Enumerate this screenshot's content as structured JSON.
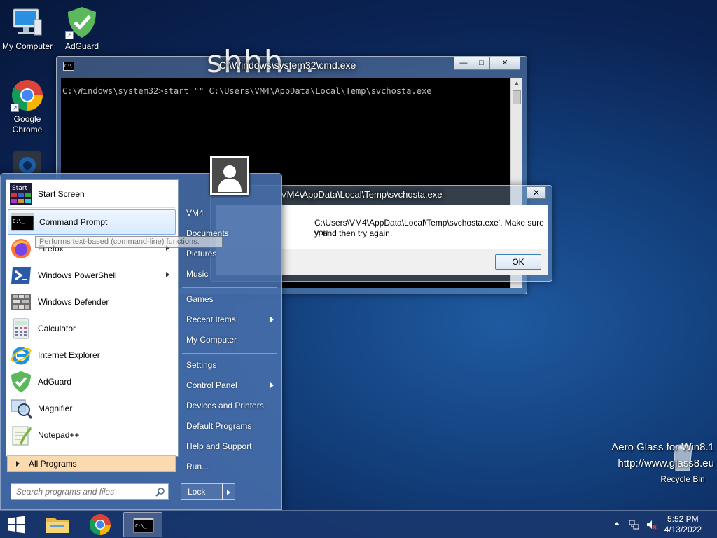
{
  "desktop": {
    "icons": [
      {
        "label": "My Computer"
      },
      {
        "label": "AdGuard"
      },
      {
        "label": "Google Chrome"
      },
      {
        "label": "Recycle Bin"
      }
    ],
    "watermark_line1": "Aero Glass for Win8.1",
    "watermark_line2": "http://www.glass8.eu"
  },
  "cmd_window": {
    "title": "C:\\Windows\\system32\\cmd.exe",
    "overlay_text": "shhh...",
    "console_line": "C:\\Windows\\system32>start \"\" C:\\Users\\VM4\\AppData\\Local\\Temp\\svchosta.exe",
    "minimize": "—",
    "maximize": "□",
    "close": "✕"
  },
  "error_dialog": {
    "title": "VM4\\AppData\\Local\\Temp\\svchosta.exe",
    "message_line1": "C:\\Users\\VM4\\AppData\\Local\\Temp\\svchosta.exe'. Make sure you",
    "message_line2": "y, and then try again.",
    "close": "✕",
    "ok_label": "OK"
  },
  "start_menu": {
    "programs": [
      {
        "label": "Start Screen",
        "icon": "start-screen-icon",
        "arrow": false
      },
      {
        "label": "Command Prompt",
        "icon": "cmd-icon",
        "arrow": false,
        "highlight": true
      },
      {
        "label": "Firefox",
        "icon": "firefox-icon",
        "arrow": true
      },
      {
        "label": "Windows PowerShell",
        "icon": "powershell-icon",
        "arrow": true
      },
      {
        "label": "Windows Defender",
        "icon": "defender-icon",
        "arrow": false
      },
      {
        "label": "Calculator",
        "icon": "calculator-icon",
        "arrow": false
      },
      {
        "label": "Internet Explorer",
        "icon": "ie-icon",
        "arrow": false
      },
      {
        "label": "AdGuard",
        "icon": "adguard-icon",
        "arrow": false
      },
      {
        "label": "Magnifier",
        "icon": "magnifier-icon",
        "arrow": false
      },
      {
        "label": "Notepad++",
        "icon": "notepadpp-icon",
        "arrow": false
      }
    ],
    "tooltip": "Performs text-based (command-line) functions.",
    "all_programs": "All Programs",
    "search_placeholder": "Search programs and files",
    "right_items": [
      {
        "label": "VM4",
        "arrow": false
      },
      {
        "label": "Documents",
        "arrow": false
      },
      {
        "label": "Pictures",
        "arrow": false
      },
      {
        "label": "Music",
        "arrow": false
      },
      {
        "label": "Games",
        "arrow": false
      },
      {
        "label": "Recent Items",
        "arrow": true
      },
      {
        "label": "My Computer",
        "arrow": false
      },
      {
        "label": "Settings",
        "arrow": false
      },
      {
        "label": "Control Panel",
        "arrow": true
      },
      {
        "label": "Devices and Printers",
        "arrow": false
      },
      {
        "label": "Default Programs",
        "arrow": false
      },
      {
        "label": "Help and Support",
        "arrow": false
      },
      {
        "label": "Run...",
        "arrow": false
      }
    ],
    "lock_label": "Lock"
  },
  "taskbar": {
    "clock_time": "5:52 PM",
    "clock_date": "4/13/2022",
    "cmd_icon_text": "C:\\_"
  },
  "colors": {
    "accent": "#1a5fb4",
    "highlight_orange": "#fcdab0"
  }
}
